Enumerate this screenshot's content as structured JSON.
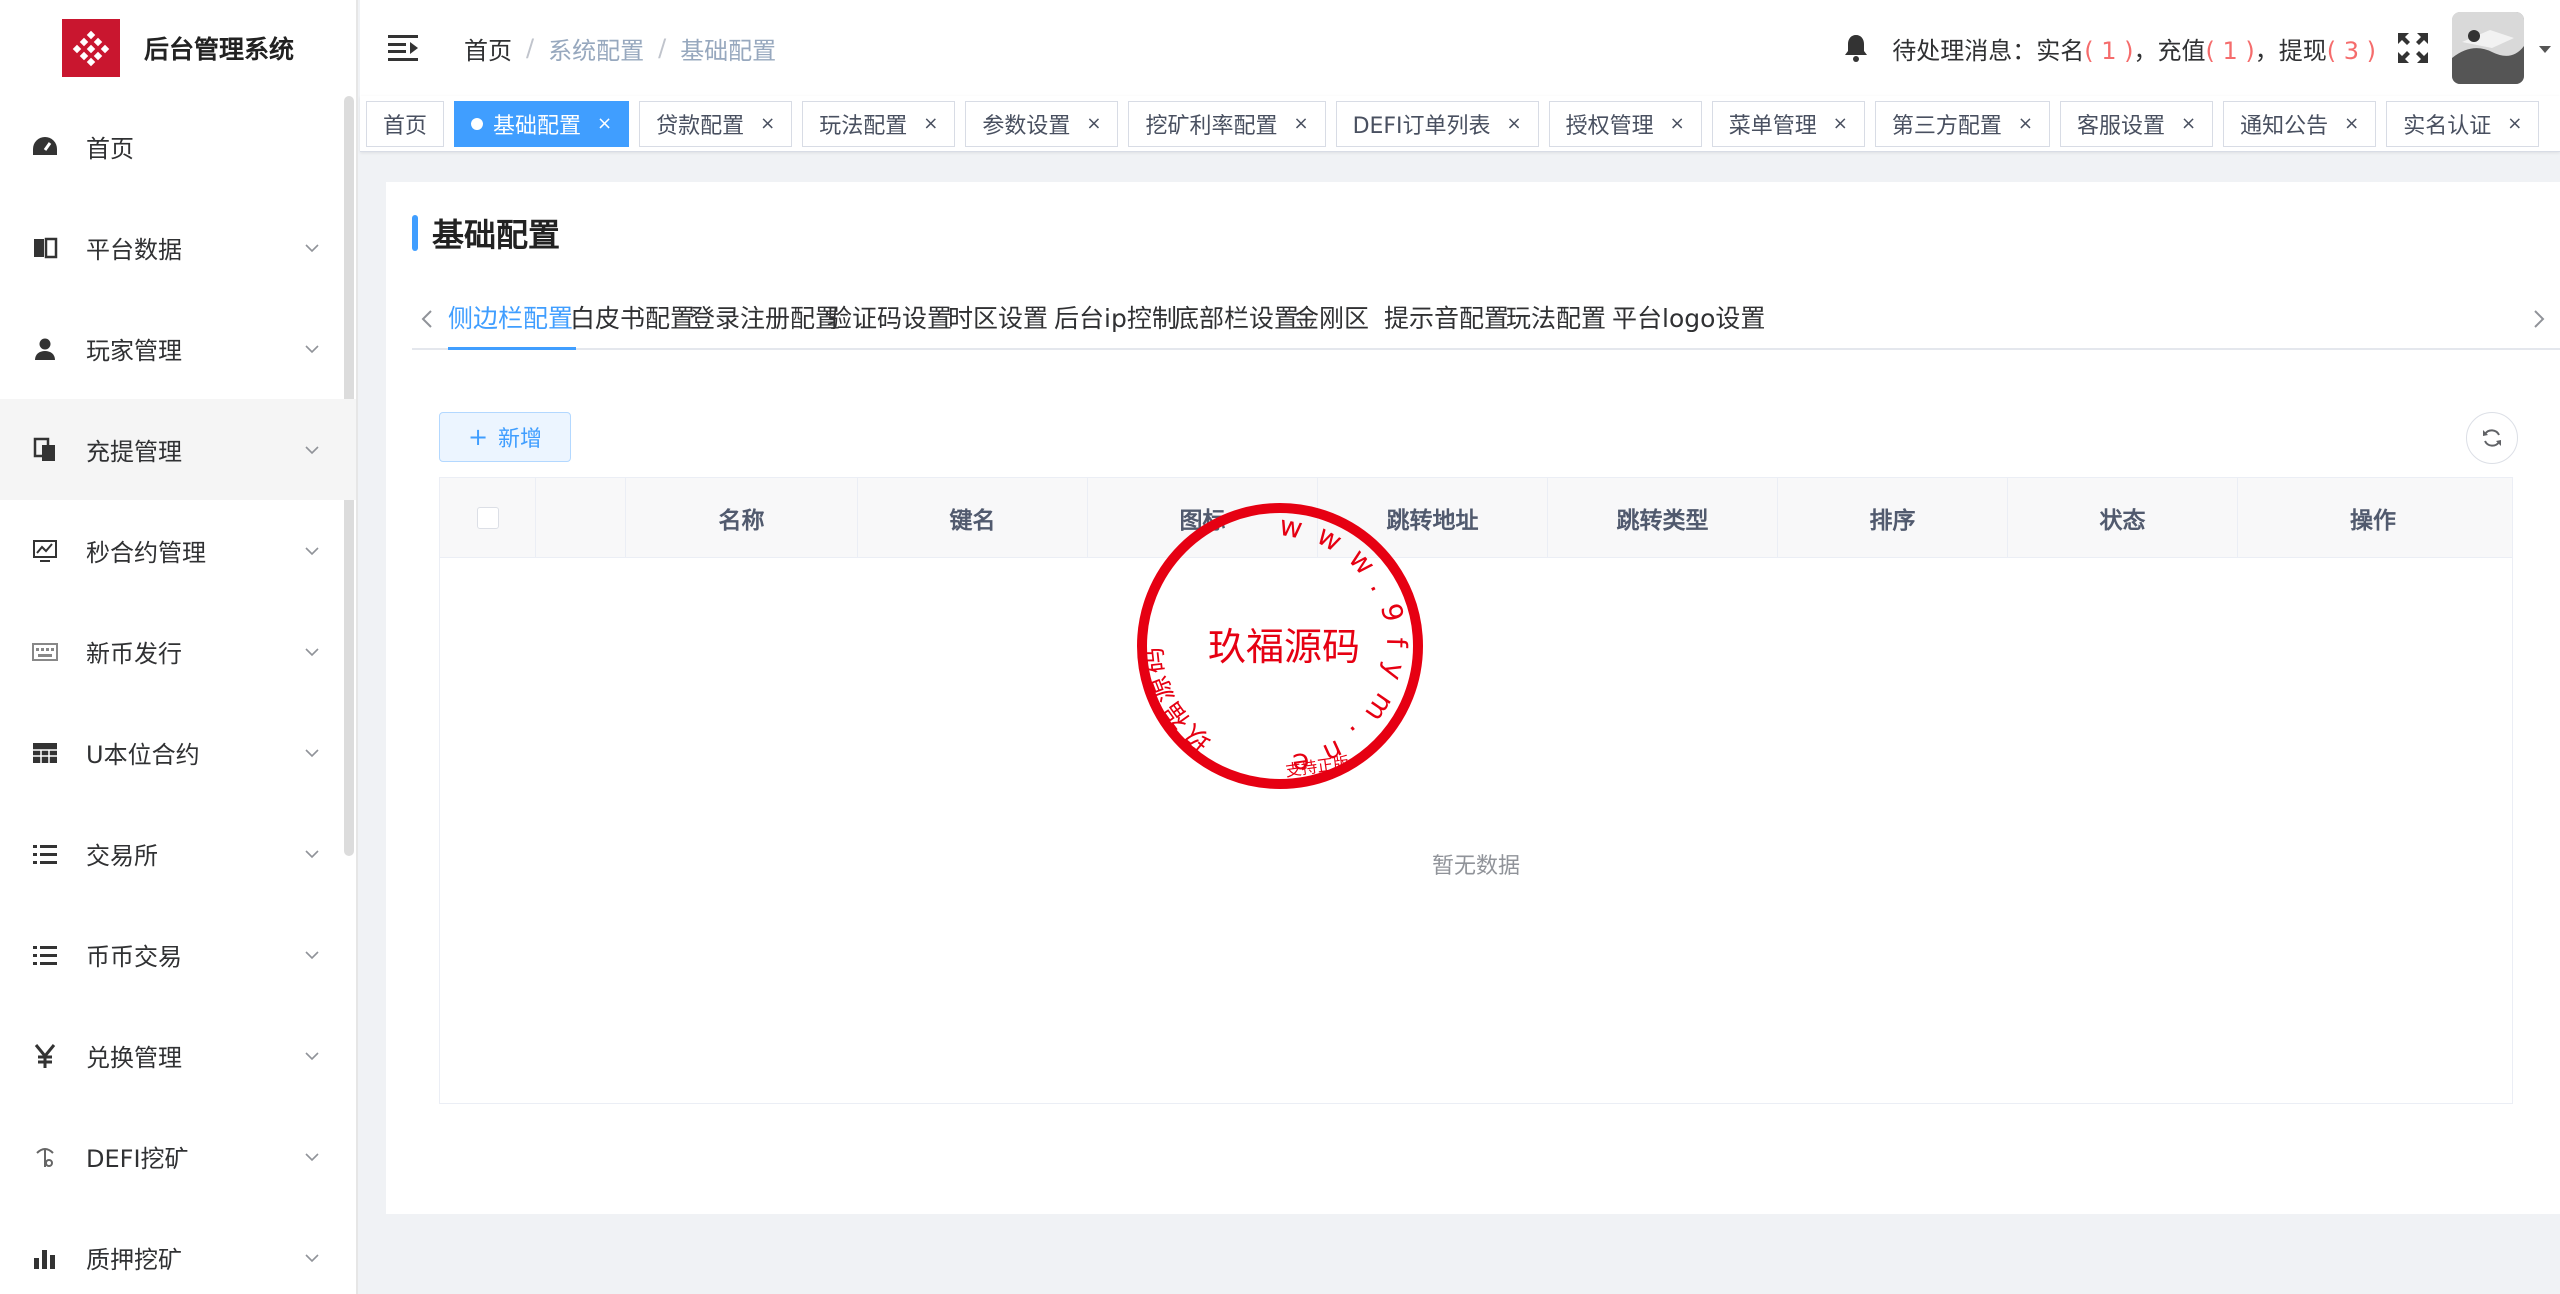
{
  "app": {
    "title": "后台管理系统"
  },
  "sidebar": {
    "items": [
      {
        "label": "首页",
        "icon": "dashboard-icon",
        "has_children": false
      },
      {
        "label": "平台数据",
        "icon": "book-icon",
        "has_children": true
      },
      {
        "label": "玩家管理",
        "icon": "user-icon",
        "has_children": true
      },
      {
        "label": "充提管理",
        "icon": "copy-icon",
        "has_children": true,
        "active": true
      },
      {
        "label": "秒合约管理",
        "icon": "monitor-chart-icon",
        "has_children": true
      },
      {
        "label": "新币发行",
        "icon": "keyboard-icon",
        "has_children": true
      },
      {
        "label": "U本位合约",
        "icon": "table-icon",
        "has_children": true
      },
      {
        "label": "交易所",
        "icon": "list-icon",
        "has_children": true
      },
      {
        "label": "币币交易",
        "icon": "list-icon",
        "has_children": true
      },
      {
        "label": "兑换管理",
        "icon": "yen-icon",
        "has_children": true
      },
      {
        "label": "DEFI挖矿",
        "icon": "pickaxe-icon",
        "has_children": true
      },
      {
        "label": "质押挖矿",
        "icon": "bar-chart-icon",
        "has_children": true
      }
    ]
  },
  "header": {
    "breadcrumb": [
      "首页",
      "系统配置",
      "基础配置"
    ],
    "notice": {
      "prefix": "待处理消息：实名",
      "realname_count": "( 1 )",
      "recharge_label": "，充值",
      "recharge_count": "( 1 )",
      "withdraw_label": "，提现",
      "withdraw_count": "( 3 )"
    }
  },
  "tags": [
    {
      "label": "首页",
      "closable": false,
      "active": false
    },
    {
      "label": "基础配置",
      "closable": true,
      "active": true
    },
    {
      "label": "贷款配置",
      "closable": true
    },
    {
      "label": "玩法配置",
      "closable": true
    },
    {
      "label": "参数设置",
      "closable": true
    },
    {
      "label": "挖矿利率配置",
      "closable": true
    },
    {
      "label": "DEFI订单列表",
      "closable": true
    },
    {
      "label": "授权管理",
      "closable": true
    },
    {
      "label": "菜单管理",
      "closable": true
    },
    {
      "label": "第三方配置",
      "closable": true
    },
    {
      "label": "客服设置",
      "closable": true
    },
    {
      "label": "通知公告",
      "closable": true
    },
    {
      "label": "实名认证",
      "closable": true
    }
  ],
  "tag_close_glyph": "×",
  "page": {
    "title": "基础配置",
    "subtabs": [
      "侧边栏配置",
      "白皮书配置",
      "登录注册配置",
      "验证码设置",
      "时区设置",
      "后台ip控制",
      "底部栏设置",
      "金刚区",
      "提示音配置",
      "玩法配置",
      "平台logo设置"
    ],
    "active_subtab": 0,
    "add_button": "新增",
    "add_button_icon": "+",
    "table": {
      "columns": [
        "",
        "",
        "名称",
        "键名",
        "图标",
        "跳转地址",
        "跳转类型",
        "排序",
        "状态",
        "操作"
      ],
      "rows": [],
      "empty_text": "暂无数据"
    }
  },
  "watermark": {
    "center_text": "玖福源码",
    "ring_text": "www.9fym.net",
    "ring_text_left": "玖福源码",
    "bottom_text": "支持正版"
  },
  "colors": {
    "accent": "#409eff",
    "danger": "#f56c6c",
    "stamp": "#e60012",
    "brand": "#c9162f"
  }
}
